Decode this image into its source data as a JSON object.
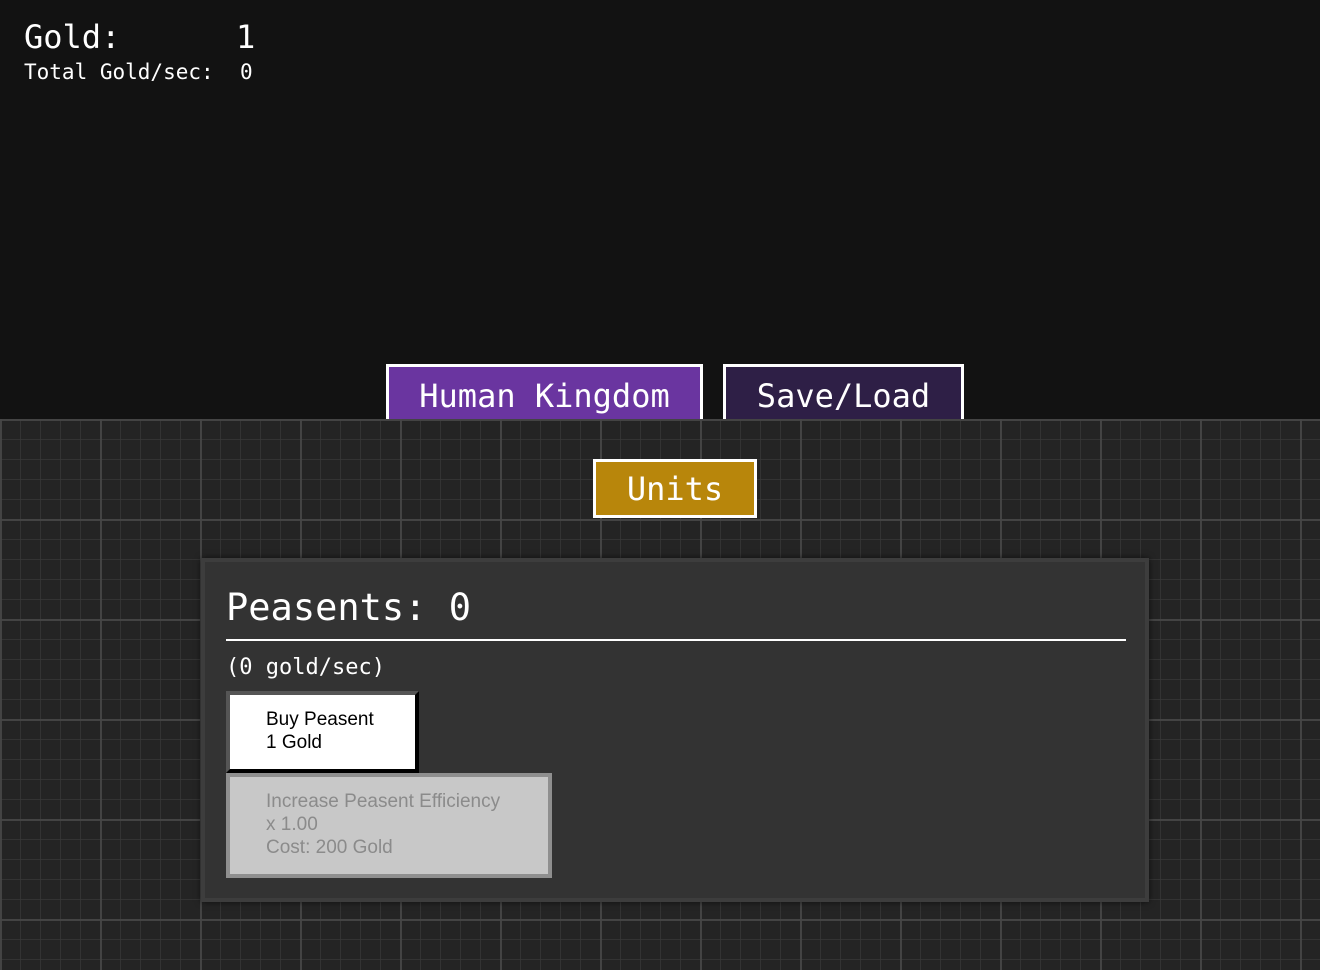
{
  "stats": {
    "gold_label": "Gold:",
    "gold_value": "1",
    "rate_label": "Total Gold/sec:",
    "rate_value": "0"
  },
  "main_tabs": [
    {
      "label": "Human Kingdom",
      "active": true,
      "color": "#6a35a0"
    },
    {
      "label": "Save/Load",
      "active": false,
      "color": "#2e1f46"
    }
  ],
  "sub_tabs": [
    {
      "label": "Units",
      "active": true,
      "color": "#b8860b"
    }
  ],
  "unit_panel": {
    "title": "Peasents: 0",
    "rate": "(0 gold/sec)",
    "buy_button": {
      "line1": "Buy Peasent",
      "line2": "1 Gold"
    },
    "upgrade_button": {
      "line1": "Increase Peasent Efficiency",
      "line2": "x 1.00",
      "line3": "Cost: 200 Gold",
      "disabled": true
    }
  }
}
